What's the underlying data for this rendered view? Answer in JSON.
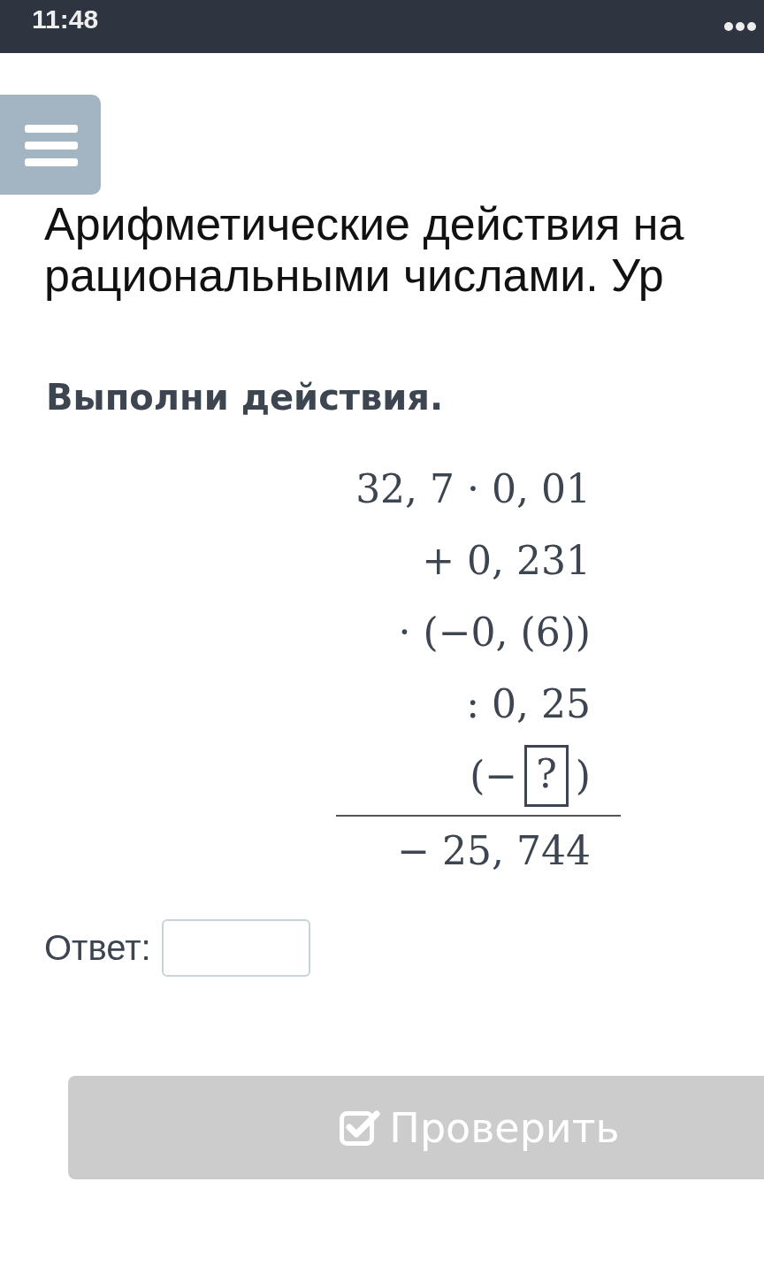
{
  "status_bar": {
    "time": "11:48"
  },
  "title": {
    "lines": [
      "Арифметические действия на",
      "рациональными числами. Ур"
    ]
  },
  "task": {
    "instruction": "Выполни действия.",
    "expression": {
      "lines": [
        {
          "kind": "text",
          "text": "32, 7 · 0, 01"
        },
        {
          "kind": "text",
          "text": "+ 0, 231"
        },
        {
          "kind": "text",
          "text": "· (−0, (6))"
        },
        {
          "kind": "text",
          "text": ": 0, 25"
        },
        {
          "kind": "blank",
          "before": "(−",
          "blank": "?",
          "after": ")"
        }
      ],
      "result": "− 25, 744"
    }
  },
  "answer": {
    "label": "Ответ:"
  },
  "check_button": {
    "label": "Проверить",
    "disabled": true
  }
}
